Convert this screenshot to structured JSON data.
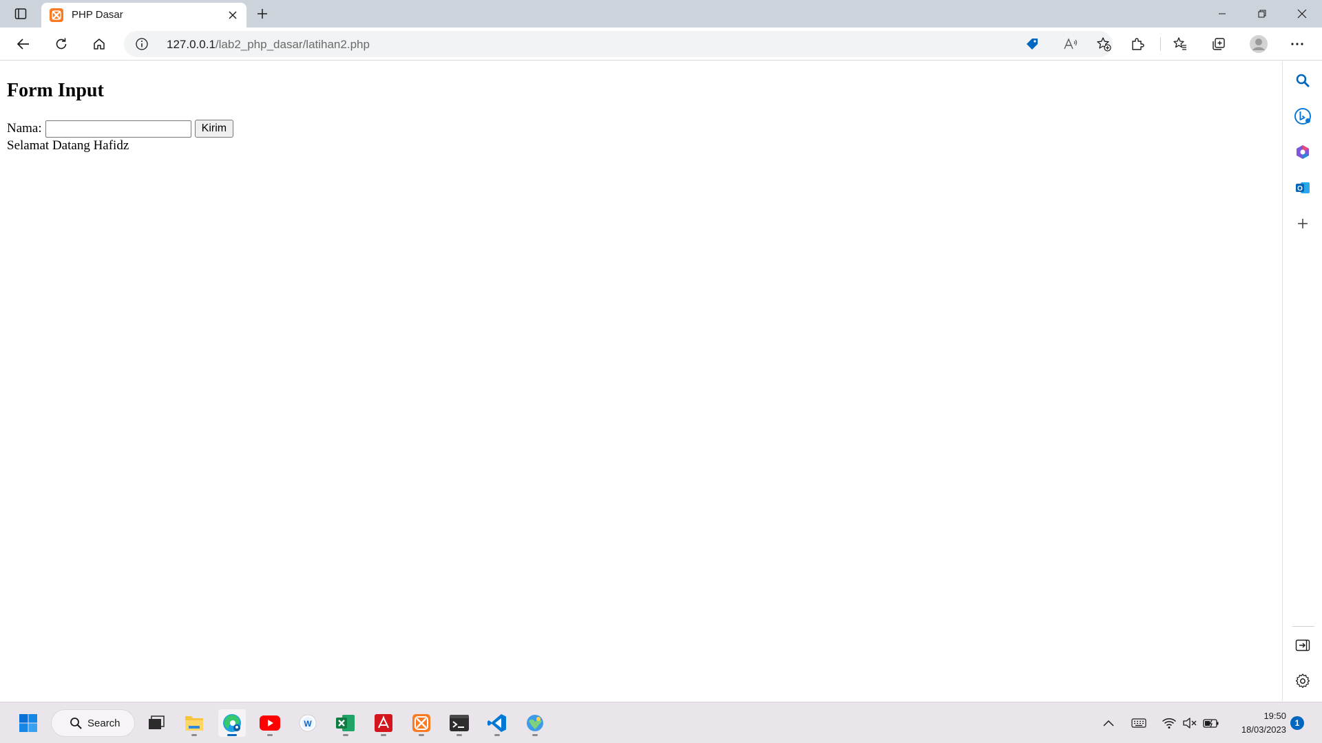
{
  "browser": {
    "tab": {
      "title": "PHP Dasar",
      "favicon": "xampp-icon"
    },
    "address": {
      "host": "127.0.0.1",
      "path": "/lab2_php_dasar/latihan2.php"
    },
    "toolbar_icons": [
      "back-icon",
      "refresh-icon",
      "home-icon",
      "info-icon",
      "shopping-tag-icon",
      "read-aloud-icon",
      "add-favorite-icon",
      "extensions-icon",
      "favorites-icon",
      "collections-icon",
      "profile-icon",
      "more-icon"
    ],
    "sidebar_icons": [
      "search-icon",
      "bing-chat-icon",
      "office-icon",
      "outlook-icon",
      "add-icon",
      "hide-sidebar-icon",
      "settings-icon"
    ]
  },
  "page": {
    "heading": "Form Input",
    "form": {
      "label": "Nama:",
      "input_value": "",
      "button_label": "Kirim"
    },
    "greeting": "Selamat Datang Hafidz"
  },
  "taskbar": {
    "search_label": "Search",
    "apps": [
      "start-icon",
      "task-view-icon",
      "file-explorer-icon",
      "edge-icon",
      "youtube-icon",
      "app-icon",
      "excel-icon",
      "acrobat-icon",
      "xampp-icon",
      "terminal-icon",
      "vscode-icon",
      "network-app-icon"
    ],
    "clock": {
      "time": "19:50",
      "date": "18/03/2023"
    },
    "notifications": "1"
  },
  "colors": {
    "accent": "#0067c0",
    "tabbar": "#cdd3da",
    "xampp": "#fb7a24"
  }
}
